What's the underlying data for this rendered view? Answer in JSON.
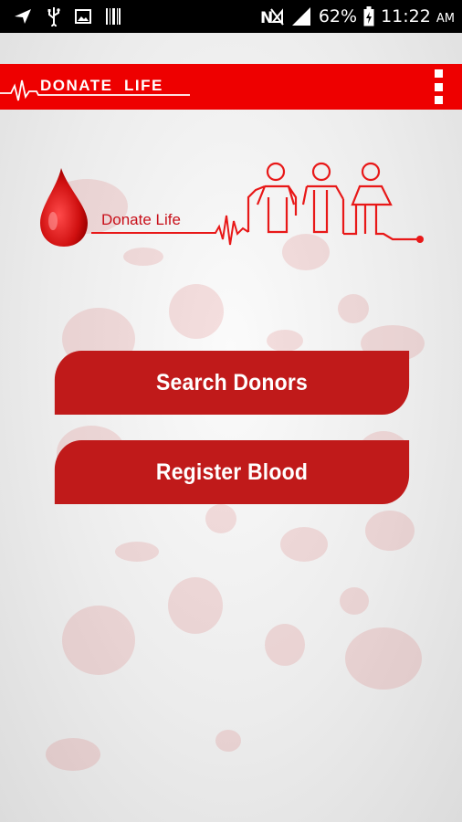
{
  "status_bar": {
    "battery": "62%",
    "time": "11:22",
    "ampm": "AM"
  },
  "app_bar": {
    "title": "DONATE  LIFE"
  },
  "logo": {
    "text": "Donate Life"
  },
  "actions": {
    "search_label": "Search Donors",
    "register_label": "Register Blood"
  },
  "colors": {
    "app_bar": "#ee0000",
    "button": "#c01a1a",
    "status_bar": "#000000"
  }
}
